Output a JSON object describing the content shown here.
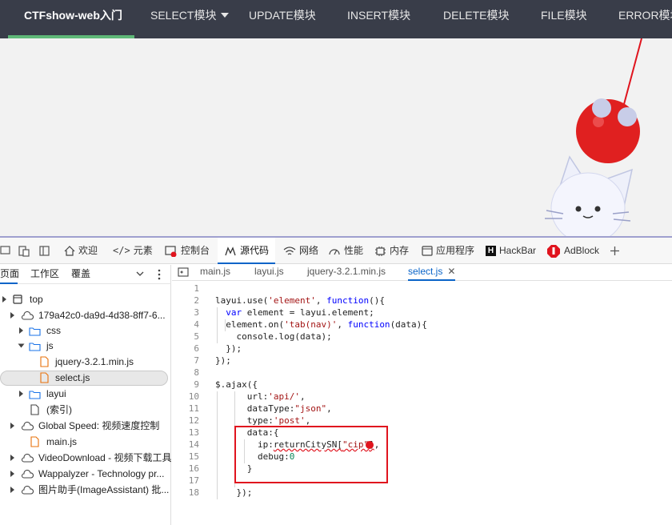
{
  "top_nav": {
    "items": [
      {
        "label": "CTFshow-web入门"
      },
      {
        "label": "SELECT模块"
      },
      {
        "label": "UPDATE模块"
      },
      {
        "label": "INSERT模块"
      },
      {
        "label": "DELETE模块"
      },
      {
        "label": "FILE模块"
      },
      {
        "label": "ERROR模块"
      }
    ]
  },
  "devtools": {
    "tabs": [
      {
        "label": "欢迎",
        "icon": "home-icon"
      },
      {
        "label": "元素",
        "icon": "code-icon"
      },
      {
        "label": "控制台",
        "icon": "console-icon"
      },
      {
        "label": "源代码",
        "icon": "sources-icon"
      },
      {
        "label": "网络",
        "icon": "wifi-icon"
      },
      {
        "label": "性能",
        "icon": "performance-icon"
      },
      {
        "label": "内存",
        "icon": "memory-icon"
      },
      {
        "label": "应用程序",
        "icon": "application-icon"
      },
      {
        "label": "HackBar",
        "icon": "hackbar-icon"
      },
      {
        "label": "AdBlock",
        "icon": "adblock-icon"
      }
    ],
    "navigator": {
      "tabs": [
        {
          "label": "页面"
        },
        {
          "label": "工作区"
        },
        {
          "label": "覆盖"
        }
      ],
      "tree": [
        {
          "label": "top"
        },
        {
          "label": "179a42c0-da9d-4d38-8ff7-6..."
        },
        {
          "label": "css"
        },
        {
          "label": "js"
        },
        {
          "label": "jquery-3.2.1.min.js"
        },
        {
          "label": "select.js"
        },
        {
          "label": "layui"
        },
        {
          "label": "(索引)"
        },
        {
          "label": "Global Speed: 视频速度控制"
        },
        {
          "label": "main.js"
        },
        {
          "label": "VideoDownload - 视频下载工具"
        },
        {
          "label": "Wappalyzer - Technology pr..."
        },
        {
          "label": "图片助手(ImageAssistant) 批..."
        }
      ]
    },
    "editor": {
      "tabs": [
        {
          "label": "main.js"
        },
        {
          "label": "layui.js"
        },
        {
          "label": "jquery-3.2.1.min.js"
        },
        {
          "label": "select.js"
        }
      ],
      "line_numbers": [
        "1",
        "2",
        "3",
        "4",
        "5",
        "6",
        "7",
        "8",
        "9",
        "10",
        "11",
        "12",
        "13",
        "14",
        "15",
        "16",
        "17",
        "18"
      ]
    }
  }
}
